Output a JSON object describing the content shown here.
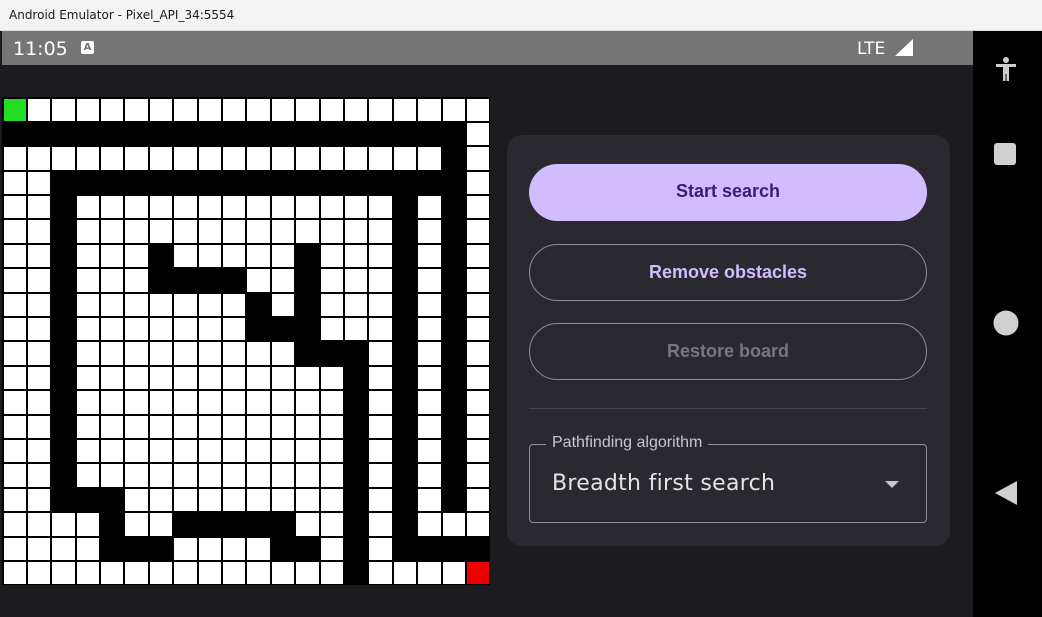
{
  "window": {
    "title": "Android Emulator - Pixel_API_34:5554"
  },
  "status_bar": {
    "time": "11:05",
    "notification_icon": "A",
    "network": "LTE"
  },
  "board": {
    "rows": [
      "S...................",
      "###################.",
      "..................#.",
      "..#################.",
      "..#.............#.#.",
      "..#.............#.#.",
      "..#...#.....#...#.#.",
      "..#...####..#...#.#.",
      "..#.......#.#...#.#.",
      "..#.......###...#.#.",
      "..#.........###.#.#.",
      "..#...........#.#.#.",
      "..#...........#.#.#.",
      "..#...........#.#.#.",
      "..#...........#.#.#.",
      "..#...........#.#.#.",
      "..###.........#.#.#.",
      "....#..#####..#.#...",
      "....###....##.#.####",
      "..............#....E"
    ]
  },
  "controls": {
    "start_search": "Start search",
    "remove_obstacles": "Remove obstacles",
    "restore_board": "Restore board"
  },
  "algorithm": {
    "label": "Pathfinding algorithm",
    "selected": "Breadth first search"
  },
  "colors": {
    "accent": "#d0bcff",
    "start": "#22dd22",
    "end": "#ee0000",
    "wall": "#000000"
  },
  "nav_icons": [
    "accessibility-icon",
    "overview-icon",
    "home-icon",
    "back-icon"
  ]
}
